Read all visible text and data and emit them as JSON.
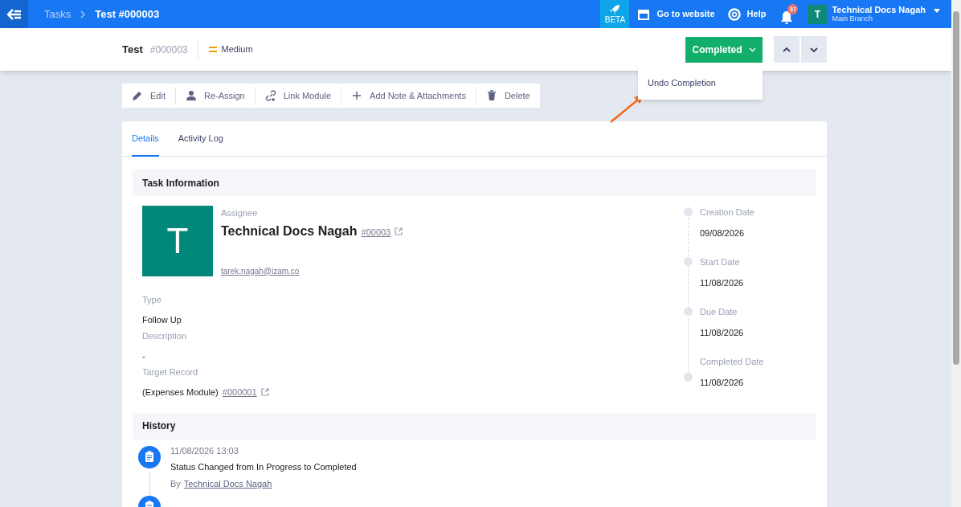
{
  "topbar": {
    "breadcrumbs": [
      {
        "label": "Tasks",
        "selected": false
      },
      {
        "label": "Test #000003",
        "selected": true
      }
    ],
    "beta": "BETA",
    "links": [
      {
        "kind": "website",
        "label": "Go to website"
      },
      {
        "kind": "help",
        "label": "Help"
      }
    ],
    "notifications": "37",
    "user": {
      "initial": "T",
      "name": "Technical Docs Nagah",
      "branch": "Main Branch"
    }
  },
  "header": {
    "title": "Test",
    "number": "#000003",
    "priority": "Medium",
    "status": "Completed",
    "menu": [
      "Undo Completion"
    ]
  },
  "actions": [
    {
      "kind": "edit",
      "label": "Edit"
    },
    {
      "kind": "assign",
      "label": "Re-Assign"
    },
    {
      "kind": "link",
      "label": "Link Module"
    },
    {
      "kind": "add",
      "label": "Add Note & Attachments"
    },
    {
      "kind": "delete",
      "label": "Delete"
    }
  ],
  "tabs": [
    {
      "label": "Details",
      "selected": true
    },
    {
      "label": "Activity Log",
      "selected": false
    }
  ],
  "task_info": {
    "title": "Task Information",
    "assignee": {
      "label": "Assignee",
      "initial": "T",
      "name": "Technical Docs Nagah",
      "code": "#00003",
      "email": "tarek.nagah@izam.co"
    },
    "fields": [
      {
        "label": "Type",
        "value": "Follow Up"
      },
      {
        "label": "Description",
        "value": "-"
      },
      {
        "label": "Target Record",
        "value": "(Expenses Module)",
        "link": "#000001"
      }
    ],
    "dates": [
      {
        "label": "Creation Date",
        "value": "09/08/2026"
      },
      {
        "label": "Start Date",
        "value": "11/08/2026"
      },
      {
        "label": "Due Date",
        "value": "11/08/2026"
      },
      {
        "label": "Completed Date",
        "value": "11/08/2026"
      }
    ]
  },
  "history": {
    "title": "History",
    "entries": [
      {
        "kind": "full",
        "time": "11/08/2026 13:03",
        "text": "Status Changed from In Progress to Completed",
        "by_prefix": "By",
        "by": "Technical Docs Nagah"
      },
      {
        "kind": "partial"
      }
    ]
  }
}
